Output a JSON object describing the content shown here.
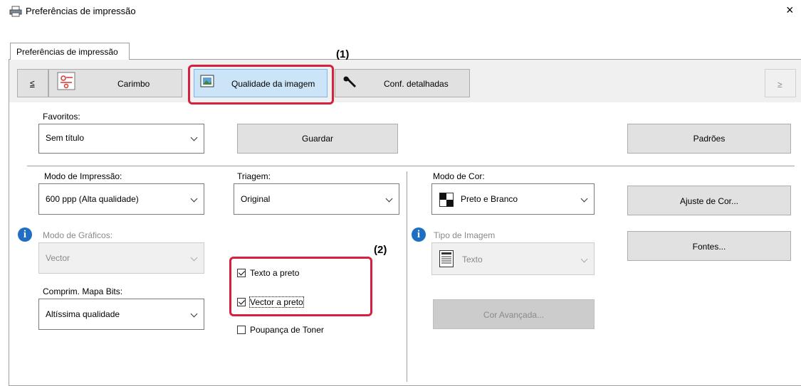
{
  "window": {
    "title": "Preferências de impressão",
    "close_glyph": "×"
  },
  "tab": {
    "label": "Preferências de impressão"
  },
  "nav": {
    "prev_label": "≤",
    "next_label": "≥",
    "items": [
      {
        "label": "Carimbo",
        "icon": "stamp-icon"
      },
      {
        "label": "Qualidade da imagem",
        "icon": "image-quality-icon"
      },
      {
        "label": "Conf. detalhadas",
        "icon": "wrench-icon"
      }
    ]
  },
  "favorites": {
    "label": "Favoritos:",
    "value": "Sem título",
    "save_label": "Guardar",
    "defaults_label": "Padrões"
  },
  "print_mode": {
    "label": "Modo de Impressão:",
    "value": "600 ppp (Alta qualidade)"
  },
  "screening": {
    "label": "Triagem:",
    "value": "Original"
  },
  "graphics_mode": {
    "label": "Modo de Gráficos:",
    "value": "Vector"
  },
  "bitmap_compression": {
    "label": "Comprim. Mapa Bits:",
    "value": "Altíssima qualidade"
  },
  "checkboxes": [
    {
      "label": "Texto a preto",
      "checked": true
    },
    {
      "label": "Vector a preto",
      "checked": true
    },
    {
      "label": "Poupança de Toner",
      "checked": false
    }
  ],
  "color_mode": {
    "label": "Modo de Cor:",
    "value": "Preto e Branco"
  },
  "image_type": {
    "label": "Tipo de Imagem",
    "value": "Texto"
  },
  "buttons": {
    "color_adjust": "Ajuste de Cor...",
    "fonts": "Fontes...",
    "advanced_color": "Cor Avançada..."
  },
  "callouts": {
    "one": "(1)",
    "two": "(2)"
  },
  "colors": {
    "highlight": "#d6203f",
    "info": "#1e6fc4",
    "selected_tab": "#cce4f7"
  }
}
